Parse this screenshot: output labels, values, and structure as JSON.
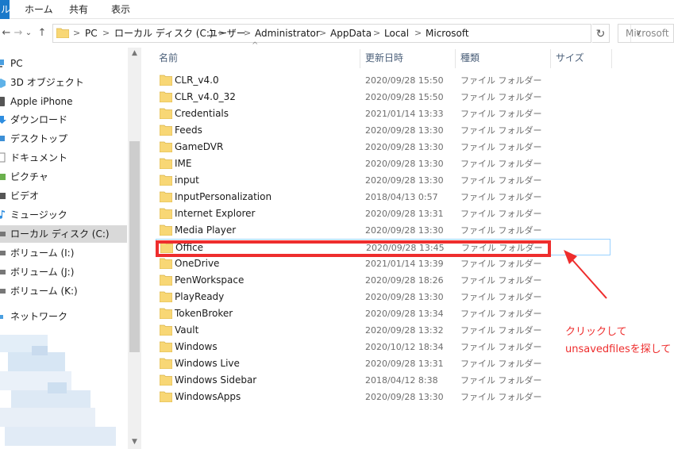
{
  "ribbon": {
    "file_tab_glyph": "ル",
    "tabs": [
      "ホーム",
      "共有",
      "表示"
    ]
  },
  "address": {
    "back": "←",
    "forward": "→",
    "recent": "⌄",
    "up": "↑",
    "crumbs": [
      "PC",
      "ローカル ディスク (C:)",
      "ユーザー",
      "Administrator",
      "AppData",
      "Local",
      "Microsoft"
    ],
    "separator": ">",
    "dropdown": "∨",
    "refresh": "↻",
    "search_placeholder": "Microsoft"
  },
  "nav": {
    "items": [
      {
        "label": "PC",
        "icon": "pc-icon"
      },
      {
        "label": "3D オブジェクト",
        "icon": "3d-objects-icon"
      },
      {
        "label": "Apple iPhone",
        "icon": "phone-icon"
      },
      {
        "label": "ダウンロード",
        "icon": "downloads-icon"
      },
      {
        "label": "デスクトップ",
        "icon": "desktop-icon"
      },
      {
        "label": "ドキュメント",
        "icon": "documents-icon"
      },
      {
        "label": "ピクチャ",
        "icon": "pictures-icon"
      },
      {
        "label": "ビデオ",
        "icon": "videos-icon"
      },
      {
        "label": "ミュージック",
        "icon": "music-icon"
      },
      {
        "label": "ローカル ディスク (C:)",
        "icon": "drive-icon",
        "selected": true
      },
      {
        "label": "ボリューム (I:)",
        "icon": "drive-icon"
      },
      {
        "label": "ボリューム (J:)",
        "icon": "drive-icon"
      },
      {
        "label": "ボリューム (K:)",
        "icon": "drive-icon"
      },
      {
        "label": "ネットワーク",
        "icon": "network-icon"
      }
    ],
    "scroll_up": "▲",
    "scroll_down": "▼"
  },
  "columns": {
    "name": "名前",
    "modified": "更新日時",
    "type": "種類",
    "size": "サイズ",
    "sort_indicator": "^"
  },
  "files": [
    {
      "name": "CLR_v4.0",
      "date": "2020/09/28 15:50",
      "type": "ファイル フォルダー"
    },
    {
      "name": "CLR_v4.0_32",
      "date": "2020/09/28 15:50",
      "type": "ファイル フォルダー"
    },
    {
      "name": "Credentials",
      "date": "2021/01/14 13:33",
      "type": "ファイル フォルダー"
    },
    {
      "name": "Feeds",
      "date": "2020/09/28 13:30",
      "type": "ファイル フォルダー"
    },
    {
      "name": "GameDVR",
      "date": "2020/09/28 13:30",
      "type": "ファイル フォルダー"
    },
    {
      "name": "IME",
      "date": "2020/09/28 13:30",
      "type": "ファイル フォルダー"
    },
    {
      "name": "input",
      "date": "2020/09/28 13:30",
      "type": "ファイル フォルダー"
    },
    {
      "name": "InputPersonalization",
      "date": "2018/04/13 0:57",
      "type": "ファイル フォルダー"
    },
    {
      "name": "Internet Explorer",
      "date": "2020/09/28 13:31",
      "type": "ファイル フォルダー"
    },
    {
      "name": "Media Player",
      "date": "2020/09/28 13:30",
      "type": "ファイル フォルダー"
    },
    {
      "name": "Office",
      "date": "2020/09/28 13:45",
      "type": "ファイル フォルダー",
      "selected": true
    },
    {
      "name": "OneDrive",
      "date": "2021/01/14 13:39",
      "type": "ファイル フォルダー"
    },
    {
      "name": "PenWorkspace",
      "date": "2020/09/28 18:26",
      "type": "ファイル フォルダー"
    },
    {
      "name": "PlayReady",
      "date": "2020/09/28 13:30",
      "type": "ファイル フォルダー"
    },
    {
      "name": "TokenBroker",
      "date": "2020/09/28 13:34",
      "type": "ファイル フォルダー"
    },
    {
      "name": "Vault",
      "date": "2020/09/28 13:32",
      "type": "ファイル フォルダー"
    },
    {
      "name": "Windows",
      "date": "2020/10/12 18:34",
      "type": "ファイル フォルダー"
    },
    {
      "name": "Windows Live",
      "date": "2020/09/28 13:31",
      "type": "ファイル フォルダー"
    },
    {
      "name": "Windows Sidebar",
      "date": "2018/04/12 8:38",
      "type": "ファイル フォルダー"
    },
    {
      "name": "WindowsApps",
      "date": "2020/09/28 13:30",
      "type": "ファイル フォルダー"
    }
  ],
  "annotation": {
    "line1": "クリックして",
    "line2": "unsavedfilesを探して",
    "color": "#ee2d2d"
  },
  "colors": {
    "accent": "#1979ca",
    "folder": "#f8d775",
    "selection_border": "#99d1ff",
    "nav_selected": "#d9d9d9"
  }
}
